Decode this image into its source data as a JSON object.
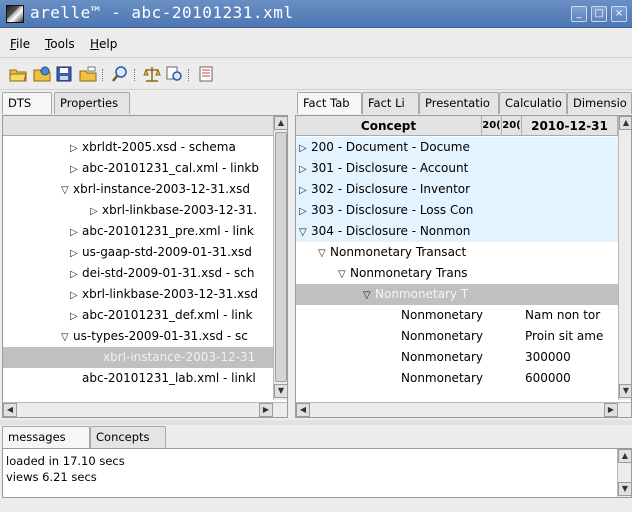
{
  "window": {
    "title": "arelle™ - abc-20101231.xml",
    "minimize_glyph": "_",
    "maximize_glyph": "□",
    "close_glyph": "×"
  },
  "menu": [
    {
      "label": "File",
      "accel": "F",
      "rest": "ile"
    },
    {
      "label": "Tools",
      "accel": "T",
      "rest": "ools"
    },
    {
      "label": "Help",
      "accel": "H",
      "rest": "elp"
    }
  ],
  "toolbar": {
    "icons": [
      "open-folder-icon",
      "open-web-icon",
      "save-icon",
      "close-icon",
      "find-icon",
      "validate-icon",
      "compare-icon",
      "view-icon"
    ]
  },
  "left_tabs": [
    "DTS",
    "Properties"
  ],
  "dts_tree": [
    {
      "glyph": "▷",
      "label": "xbrldt-2005.xsd - schema"
    },
    {
      "glyph": "▷",
      "label": "abc-20101231_cal.xml - linkb"
    },
    {
      "glyph": "▽",
      "label": "xbrl-instance-2003-12-31.xsd"
    },
    {
      "glyph": "▷",
      "label": "xbrl-linkbase-2003-12-31."
    },
    {
      "glyph": "▷",
      "label": "abc-20101231_pre.xml - link"
    },
    {
      "glyph": "▷",
      "label": "us-gaap-std-2009-01-31.xsd"
    },
    {
      "glyph": "▷",
      "label": "dei-std-2009-01-31.xsd - sch"
    },
    {
      "glyph": "▷",
      "label": "xbrl-linkbase-2003-12-31.xsd"
    },
    {
      "glyph": "▷",
      "label": "abc-20101231_def.xml - link"
    },
    {
      "glyph": "▽",
      "label": "us-types-2009-01-31.xsd - sc"
    },
    {
      "glyph": "",
      "label": "xbrl-instance-2003-12-31"
    },
    {
      "glyph": "",
      "label": "abc-20101231_lab.xml - linkl"
    }
  ],
  "right_tabs": [
    "Fact Tab",
    "Fact Li",
    "Presentatio",
    "Calculatio",
    "Dimensio"
  ],
  "fact_table": {
    "columns": [
      "Concept",
      "20(",
      "20(",
      "2010-12-31"
    ],
    "rows": [
      {
        "glyph": "▷",
        "concept": "200 - Document - Docume",
        "value": ""
      },
      {
        "glyph": "▷",
        "concept": "301 - Disclosure - Account",
        "value": ""
      },
      {
        "glyph": "▷",
        "concept": "302 - Disclosure - Inventor",
        "value": ""
      },
      {
        "glyph": "▷",
        "concept": "303 - Disclosure - Loss Con",
        "value": ""
      },
      {
        "glyph": "▽",
        "concept": "304 - Disclosure - Nonmon",
        "value": ""
      },
      {
        "glyph": "▽",
        "concept": "Nonmonetary Transact",
        "value": ""
      },
      {
        "glyph": "▽",
        "concept": "Nonmonetary Trans",
        "value": ""
      },
      {
        "glyph": "▽",
        "concept": "Nonmonetary T",
        "value": ""
      },
      {
        "glyph": "",
        "concept": "Nonmonetary",
        "value": "Nam non tor"
      },
      {
        "glyph": "",
        "concept": "Nonmonetary",
        "value": "Proin sit ame"
      },
      {
        "glyph": "",
        "concept": "Nonmonetary",
        "value": "300000"
      },
      {
        "glyph": "",
        "concept": "Nonmonetary",
        "value": "600000"
      }
    ]
  },
  "bottom_tabs": [
    "messages",
    "Concepts"
  ],
  "messages": [
    "loaded in 17.10 secs",
    "views 6.21 secs"
  ],
  "scroll": {
    "up": "▲",
    "down": "▼",
    "left": "◀",
    "right": "▶"
  }
}
